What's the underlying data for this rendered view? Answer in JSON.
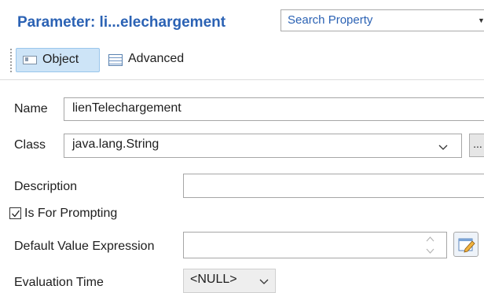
{
  "header": {
    "title": "Parameter: li...elechargement",
    "search_placeholder": "Search Property"
  },
  "tabs": [
    {
      "label": "Object",
      "selected": true
    },
    {
      "label": "Advanced",
      "selected": false
    }
  ],
  "form": {
    "name_label": "Name",
    "name_value": "lienTelechargement",
    "class_label": "Class",
    "class_value": "java.lang.String",
    "ellipsis_label": "...",
    "description_label": "Description",
    "description_value": "",
    "prompting_label": "Is For Prompting",
    "prompting_checked": true,
    "default_value_label": "Default Value Expression",
    "default_value_value": "",
    "evaluation_time_label": "Evaluation Time",
    "evaluation_time_value": "<NULL>"
  },
  "colors": {
    "title": "#2b62b4",
    "tab_selected_bg": "#cde4f7",
    "tab_selected_border": "#99c6ec"
  }
}
